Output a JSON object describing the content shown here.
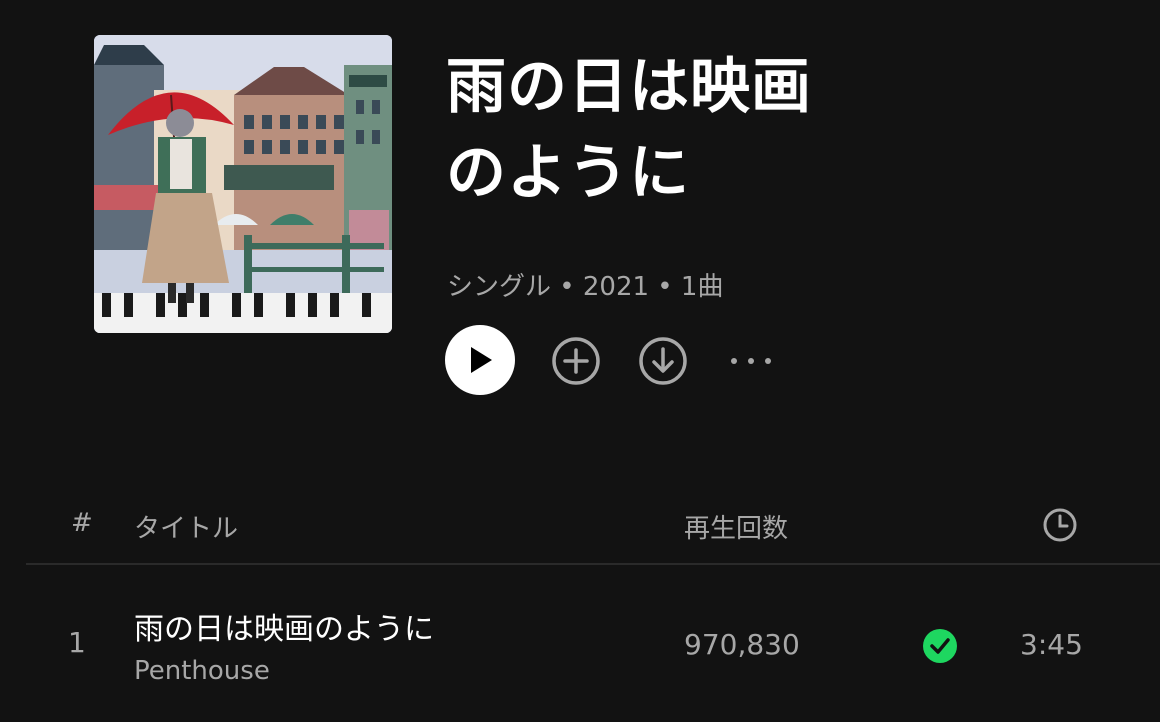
{
  "album": {
    "title": "雨の日は映画のように",
    "meta": "シングル • 2021 • 1曲",
    "cover_alt": "album-artwork"
  },
  "actions": {
    "play": "play-icon",
    "add": "plus-circle-icon",
    "download": "download-icon",
    "more": "more-icon"
  },
  "table": {
    "headers": {
      "number": "#",
      "title": "タイトル",
      "plays": "再生回数",
      "duration_icon": "clock-icon"
    },
    "tracks": [
      {
        "number": "1",
        "title": "雨の日は映画のように",
        "artist": "Penthouse",
        "plays": "970,830",
        "downloaded": true,
        "duration": "3:45"
      }
    ]
  },
  "colors": {
    "background": "#121212",
    "text_primary": "#ffffff",
    "text_secondary": "#a7a7a7",
    "accent_green": "#1ed760"
  }
}
